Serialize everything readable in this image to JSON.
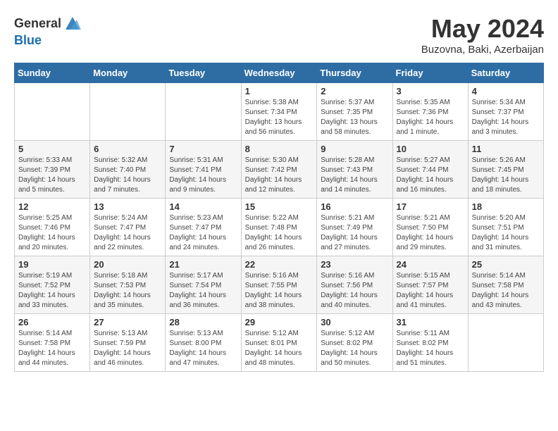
{
  "header": {
    "logo_general": "General",
    "logo_blue": "Blue",
    "month_title": "May 2024",
    "location": "Buzovna, Baki, Azerbaijan"
  },
  "weekdays": [
    "Sunday",
    "Monday",
    "Tuesday",
    "Wednesday",
    "Thursday",
    "Friday",
    "Saturday"
  ],
  "weeks": [
    [
      {
        "day": "",
        "sunrise": "",
        "sunset": "",
        "daylight": ""
      },
      {
        "day": "",
        "sunrise": "",
        "sunset": "",
        "daylight": ""
      },
      {
        "day": "",
        "sunrise": "",
        "sunset": "",
        "daylight": ""
      },
      {
        "day": "1",
        "sunrise": "Sunrise: 5:38 AM",
        "sunset": "Sunset: 7:34 PM",
        "daylight": "Daylight: 13 hours and 56 minutes."
      },
      {
        "day": "2",
        "sunrise": "Sunrise: 5:37 AM",
        "sunset": "Sunset: 7:35 PM",
        "daylight": "Daylight: 13 hours and 58 minutes."
      },
      {
        "day": "3",
        "sunrise": "Sunrise: 5:35 AM",
        "sunset": "Sunset: 7:36 PM",
        "daylight": "Daylight: 14 hours and 1 minute."
      },
      {
        "day": "4",
        "sunrise": "Sunrise: 5:34 AM",
        "sunset": "Sunset: 7:37 PM",
        "daylight": "Daylight: 14 hours and 3 minutes."
      }
    ],
    [
      {
        "day": "5",
        "sunrise": "Sunrise: 5:33 AM",
        "sunset": "Sunset: 7:39 PM",
        "daylight": "Daylight: 14 hours and 5 minutes."
      },
      {
        "day": "6",
        "sunrise": "Sunrise: 5:32 AM",
        "sunset": "Sunset: 7:40 PM",
        "daylight": "Daylight: 14 hours and 7 minutes."
      },
      {
        "day": "7",
        "sunrise": "Sunrise: 5:31 AM",
        "sunset": "Sunset: 7:41 PM",
        "daylight": "Daylight: 14 hours and 9 minutes."
      },
      {
        "day": "8",
        "sunrise": "Sunrise: 5:30 AM",
        "sunset": "Sunset: 7:42 PM",
        "daylight": "Daylight: 14 hours and 12 minutes."
      },
      {
        "day": "9",
        "sunrise": "Sunrise: 5:28 AM",
        "sunset": "Sunset: 7:43 PM",
        "daylight": "Daylight: 14 hours and 14 minutes."
      },
      {
        "day": "10",
        "sunrise": "Sunrise: 5:27 AM",
        "sunset": "Sunset: 7:44 PM",
        "daylight": "Daylight: 14 hours and 16 minutes."
      },
      {
        "day": "11",
        "sunrise": "Sunrise: 5:26 AM",
        "sunset": "Sunset: 7:45 PM",
        "daylight": "Daylight: 14 hours and 18 minutes."
      }
    ],
    [
      {
        "day": "12",
        "sunrise": "Sunrise: 5:25 AM",
        "sunset": "Sunset: 7:46 PM",
        "daylight": "Daylight: 14 hours and 20 minutes."
      },
      {
        "day": "13",
        "sunrise": "Sunrise: 5:24 AM",
        "sunset": "Sunset: 7:47 PM",
        "daylight": "Daylight: 14 hours and 22 minutes."
      },
      {
        "day": "14",
        "sunrise": "Sunrise: 5:23 AM",
        "sunset": "Sunset: 7:47 PM",
        "daylight": "Daylight: 14 hours and 24 minutes."
      },
      {
        "day": "15",
        "sunrise": "Sunrise: 5:22 AM",
        "sunset": "Sunset: 7:48 PM",
        "daylight": "Daylight: 14 hours and 26 minutes."
      },
      {
        "day": "16",
        "sunrise": "Sunrise: 5:21 AM",
        "sunset": "Sunset: 7:49 PM",
        "daylight": "Daylight: 14 hours and 27 minutes."
      },
      {
        "day": "17",
        "sunrise": "Sunrise: 5:21 AM",
        "sunset": "Sunset: 7:50 PM",
        "daylight": "Daylight: 14 hours and 29 minutes."
      },
      {
        "day": "18",
        "sunrise": "Sunrise: 5:20 AM",
        "sunset": "Sunset: 7:51 PM",
        "daylight": "Daylight: 14 hours and 31 minutes."
      }
    ],
    [
      {
        "day": "19",
        "sunrise": "Sunrise: 5:19 AM",
        "sunset": "Sunset: 7:52 PM",
        "daylight": "Daylight: 14 hours and 33 minutes."
      },
      {
        "day": "20",
        "sunrise": "Sunrise: 5:18 AM",
        "sunset": "Sunset: 7:53 PM",
        "daylight": "Daylight: 14 hours and 35 minutes."
      },
      {
        "day": "21",
        "sunrise": "Sunrise: 5:17 AM",
        "sunset": "Sunset: 7:54 PM",
        "daylight": "Daylight: 14 hours and 36 minutes."
      },
      {
        "day": "22",
        "sunrise": "Sunrise: 5:16 AM",
        "sunset": "Sunset: 7:55 PM",
        "daylight": "Daylight: 14 hours and 38 minutes."
      },
      {
        "day": "23",
        "sunrise": "Sunrise: 5:16 AM",
        "sunset": "Sunset: 7:56 PM",
        "daylight": "Daylight: 14 hours and 40 minutes."
      },
      {
        "day": "24",
        "sunrise": "Sunrise: 5:15 AM",
        "sunset": "Sunset: 7:57 PM",
        "daylight": "Daylight: 14 hours and 41 minutes."
      },
      {
        "day": "25",
        "sunrise": "Sunrise: 5:14 AM",
        "sunset": "Sunset: 7:58 PM",
        "daylight": "Daylight: 14 hours and 43 minutes."
      }
    ],
    [
      {
        "day": "26",
        "sunrise": "Sunrise: 5:14 AM",
        "sunset": "Sunset: 7:58 PM",
        "daylight": "Daylight: 14 hours and 44 minutes."
      },
      {
        "day": "27",
        "sunrise": "Sunrise: 5:13 AM",
        "sunset": "Sunset: 7:59 PM",
        "daylight": "Daylight: 14 hours and 46 minutes."
      },
      {
        "day": "28",
        "sunrise": "Sunrise: 5:13 AM",
        "sunset": "Sunset: 8:00 PM",
        "daylight": "Daylight: 14 hours and 47 minutes."
      },
      {
        "day": "29",
        "sunrise": "Sunrise: 5:12 AM",
        "sunset": "Sunset: 8:01 PM",
        "daylight": "Daylight: 14 hours and 48 minutes."
      },
      {
        "day": "30",
        "sunrise": "Sunrise: 5:12 AM",
        "sunset": "Sunset: 8:02 PM",
        "daylight": "Daylight: 14 hours and 50 minutes."
      },
      {
        "day": "31",
        "sunrise": "Sunrise: 5:11 AM",
        "sunset": "Sunset: 8:02 PM",
        "daylight": "Daylight: 14 hours and 51 minutes."
      },
      {
        "day": "",
        "sunrise": "",
        "sunset": "",
        "daylight": ""
      }
    ]
  ]
}
